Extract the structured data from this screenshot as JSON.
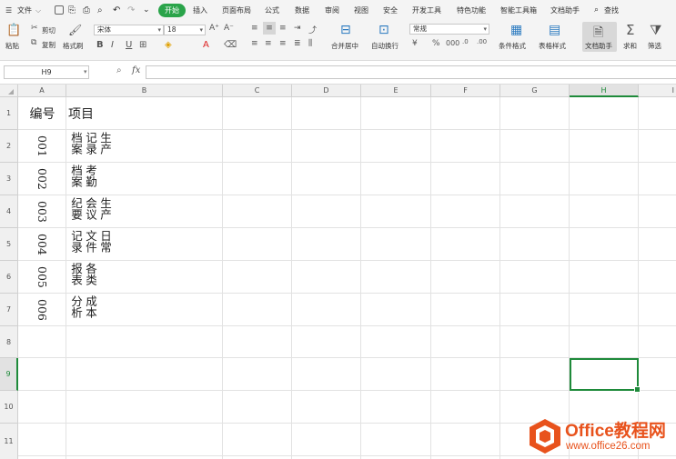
{
  "menubar": {
    "file": "文件",
    "tabs": [
      "开始",
      "插入",
      "页面布局",
      "公式",
      "数据",
      "审阅",
      "视图",
      "安全",
      "开发工具",
      "特色功能",
      "智能工具箱",
      "文档助手"
    ],
    "search": "查找"
  },
  "ribbon": {
    "paste": "粘贴",
    "cut": "剪切",
    "copy": "复制",
    "format_painter": "格式刷",
    "font_name": "宋体",
    "font_size": "18",
    "merge_center": "合并居中",
    "auto_wrap": "自动换行",
    "number_format": "常规",
    "conditional_format": "条件格式",
    "table_style": "表格样式",
    "doc_assistant": "文档助手",
    "sum": "求和",
    "filter": "筛选"
  },
  "formula_bar": {
    "name_box": "H9",
    "fx": "fx",
    "formula": ""
  },
  "grid": {
    "columns": [
      "A",
      "B",
      "C",
      "D",
      "E",
      "F",
      "G",
      "H",
      "I"
    ],
    "rows": [
      "1",
      "2",
      "3",
      "4",
      "5",
      "6",
      "7",
      "8",
      "9",
      "10",
      "11"
    ],
    "header_a": "编号",
    "header_b": "项目",
    "data": [
      {
        "code": "001",
        "item": "生产记录档案"
      },
      {
        "code": "002",
        "item": "考勤档案"
      },
      {
        "code": "003",
        "item": "生产会议纪要"
      },
      {
        "code": "004",
        "item": "日常文件记录"
      },
      {
        "code": "005",
        "item": "各类报表"
      },
      {
        "code": "006",
        "item": "成本分析"
      }
    ],
    "selected_cell": "H9"
  },
  "watermark": {
    "brand": "Office教程网",
    "url": "www.office26.com"
  },
  "colors": {
    "accent": "#2aa44a",
    "selection": "#1e8a3a",
    "logo_orange": "#e8521c"
  }
}
